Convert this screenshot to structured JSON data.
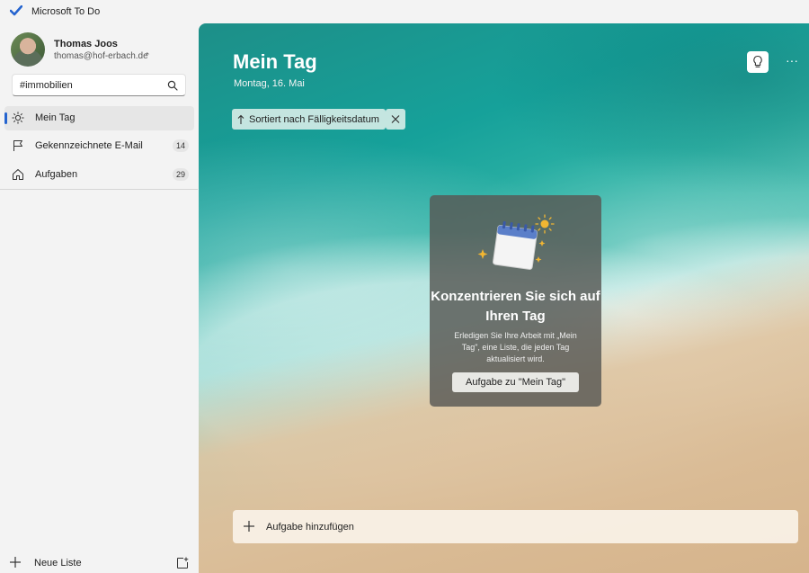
{
  "app": {
    "title": "Microsoft To Do",
    "accent": "#2564cf"
  },
  "user": {
    "name": "Thomas Joos",
    "email": "thomas@hof-erbach.de",
    "avatar_icon": "user-avatar"
  },
  "search": {
    "value": "#immobilien",
    "icon": "search-icon"
  },
  "sidebar": {
    "items": [
      {
        "label": "Mein Tag",
        "icon": "sun-icon",
        "count": "",
        "active": true
      },
      {
        "label": "Gekennzeichnete E-Mail",
        "icon": "flag-icon",
        "count": "14",
        "active": false
      },
      {
        "label": "Aufgaben",
        "icon": "home-icon",
        "count": "29",
        "active": false
      }
    ],
    "new_list_label": "Neue Liste"
  },
  "main": {
    "title": "Mein Tag",
    "date": "Montag, 16. Mai",
    "sort_label": "Sortiert nach Fälligkeitsdatum",
    "more_label": "···",
    "focus": {
      "title": "Konzentrieren Sie sich auf Ihren Tag",
      "text": "Erledigen Sie Ihre Arbeit mit „Mein Tag\", eine Liste, die jeden Tag aktualisiert wird.",
      "button": "Aufgabe zu \"Mein Tag\""
    },
    "add_task_label": "Aufgabe hinzufügen"
  }
}
